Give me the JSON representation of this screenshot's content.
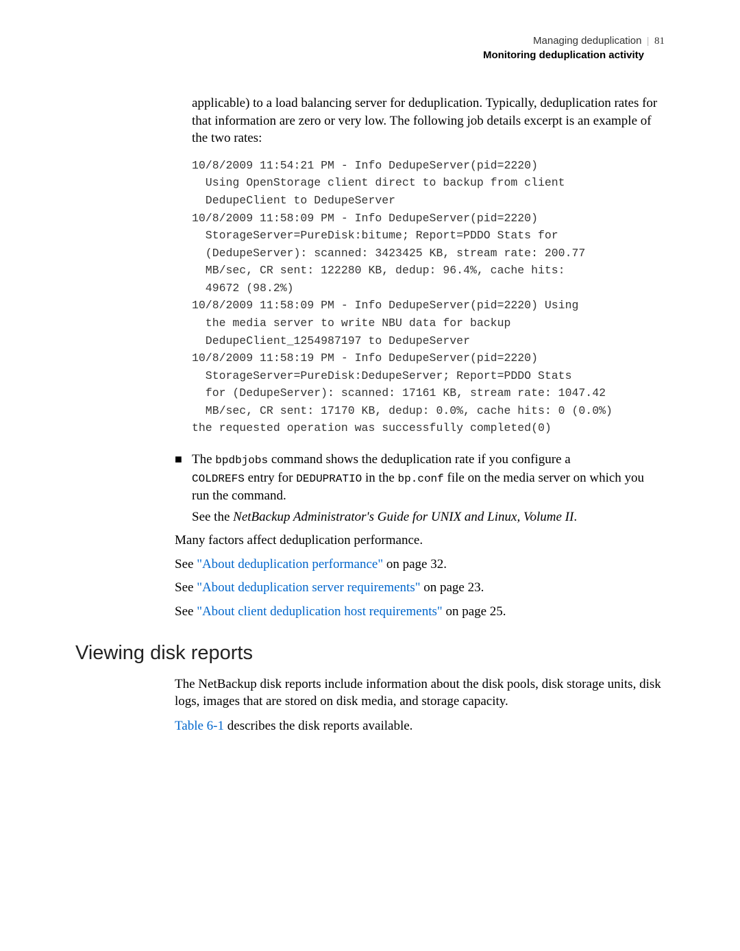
{
  "header": {
    "chapter": "Managing deduplication",
    "pagenum": "81",
    "section": "Monitoring deduplication activity"
  },
  "intro": "applicable) to a load balancing server for deduplication. Typically, deduplication rates for that information are zero or very low. The following job details excerpt is an example of the two rates:",
  "code": "10/8/2009 11:54:21 PM - Info DedupeServer(pid=2220)\n  Using OpenStorage client direct to backup from client\n  DedupeClient to DedupeServer\n10/8/2009 11:58:09 PM - Info DedupeServer(pid=2220)\n  StorageServer=PureDisk:bitume; Report=PDDO Stats for\n  (DedupeServer): scanned: 3423425 KB, stream rate: 200.77\n  MB/sec, CR sent: 122280 KB, dedup: 96.4%, cache hits:\n  49672 (98.2%)\n10/8/2009 11:58:09 PM - Info DedupeServer(pid=2220) Using\n  the media server to write NBU data for backup\n  DedupeClient_1254987197 to DedupeServer\n10/8/2009 11:58:19 PM - Info DedupeServer(pid=2220)\n  StorageServer=PureDisk:DedupeServer; Report=PDDO Stats\n  for (DedupeServer): scanned: 17161 KB, stream rate: 1047.42\n  MB/sec, CR sent: 17170 KB, dedup: 0.0%, cache hits: 0 (0.0%)\nthe requested operation was successfully completed(0)",
  "bullet": {
    "pre1": "The ",
    "cmd1": "bpdbjobs",
    "mid1": " command shows the deduplication rate if you configure a ",
    "cmd2": "COLDREFS",
    "mid2": " entry for ",
    "cmd3": "DEDUPRATIO",
    "mid3": " in the ",
    "cmd4": "bp.conf",
    "mid4": " file on the media server on which you run the command.",
    "see_pre": "See the ",
    "see_title": "NetBackup Administrator's Guide for UNIX and Linux, Volume II",
    "see_post": "."
  },
  "paras": {
    "p1": "Many factors affect deduplication performance.",
    "see1_pre": "See ",
    "see1_link": "\"About deduplication performance\"",
    "see1_post": " on page 32.",
    "see2_pre": "See ",
    "see2_link": "\"About deduplication server requirements\"",
    "see2_post": " on page 23.",
    "see3_pre": "See ",
    "see3_link": "\"About client deduplication host requirements\"",
    "see3_post": " on page 25."
  },
  "heading": "Viewing disk reports",
  "section": {
    "p1": "The NetBackup disk reports include information about the disk pools, disk storage units, disk logs, images that are stored on disk media, and storage capacity.",
    "p2_link": "Table 6-1",
    "p2_post": " describes the disk reports available."
  }
}
